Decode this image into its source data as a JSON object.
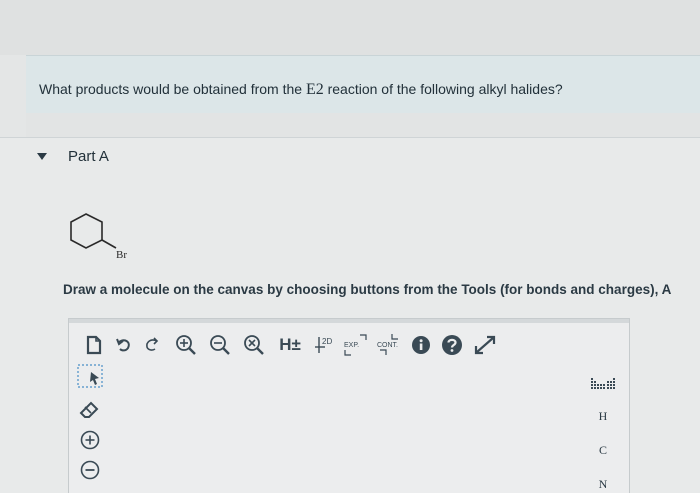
{
  "question": {
    "text_before": "What products would be obtained from the ",
    "reaction": "E2",
    "text_after": " reaction of the following alkyl halides?"
  },
  "part": {
    "label": "Part A"
  },
  "molecule": {
    "substituent": "Br"
  },
  "instruction": "Draw a molecule on the canvas by choosing buttons from the Tools (for bonds and charges), A",
  "toolbar": {
    "h_label": "H±",
    "two_d_label": "2D",
    "exp_label": "EXP.",
    "cont_label": "CONT."
  },
  "atoms": [
    "H",
    "C",
    "N"
  ]
}
